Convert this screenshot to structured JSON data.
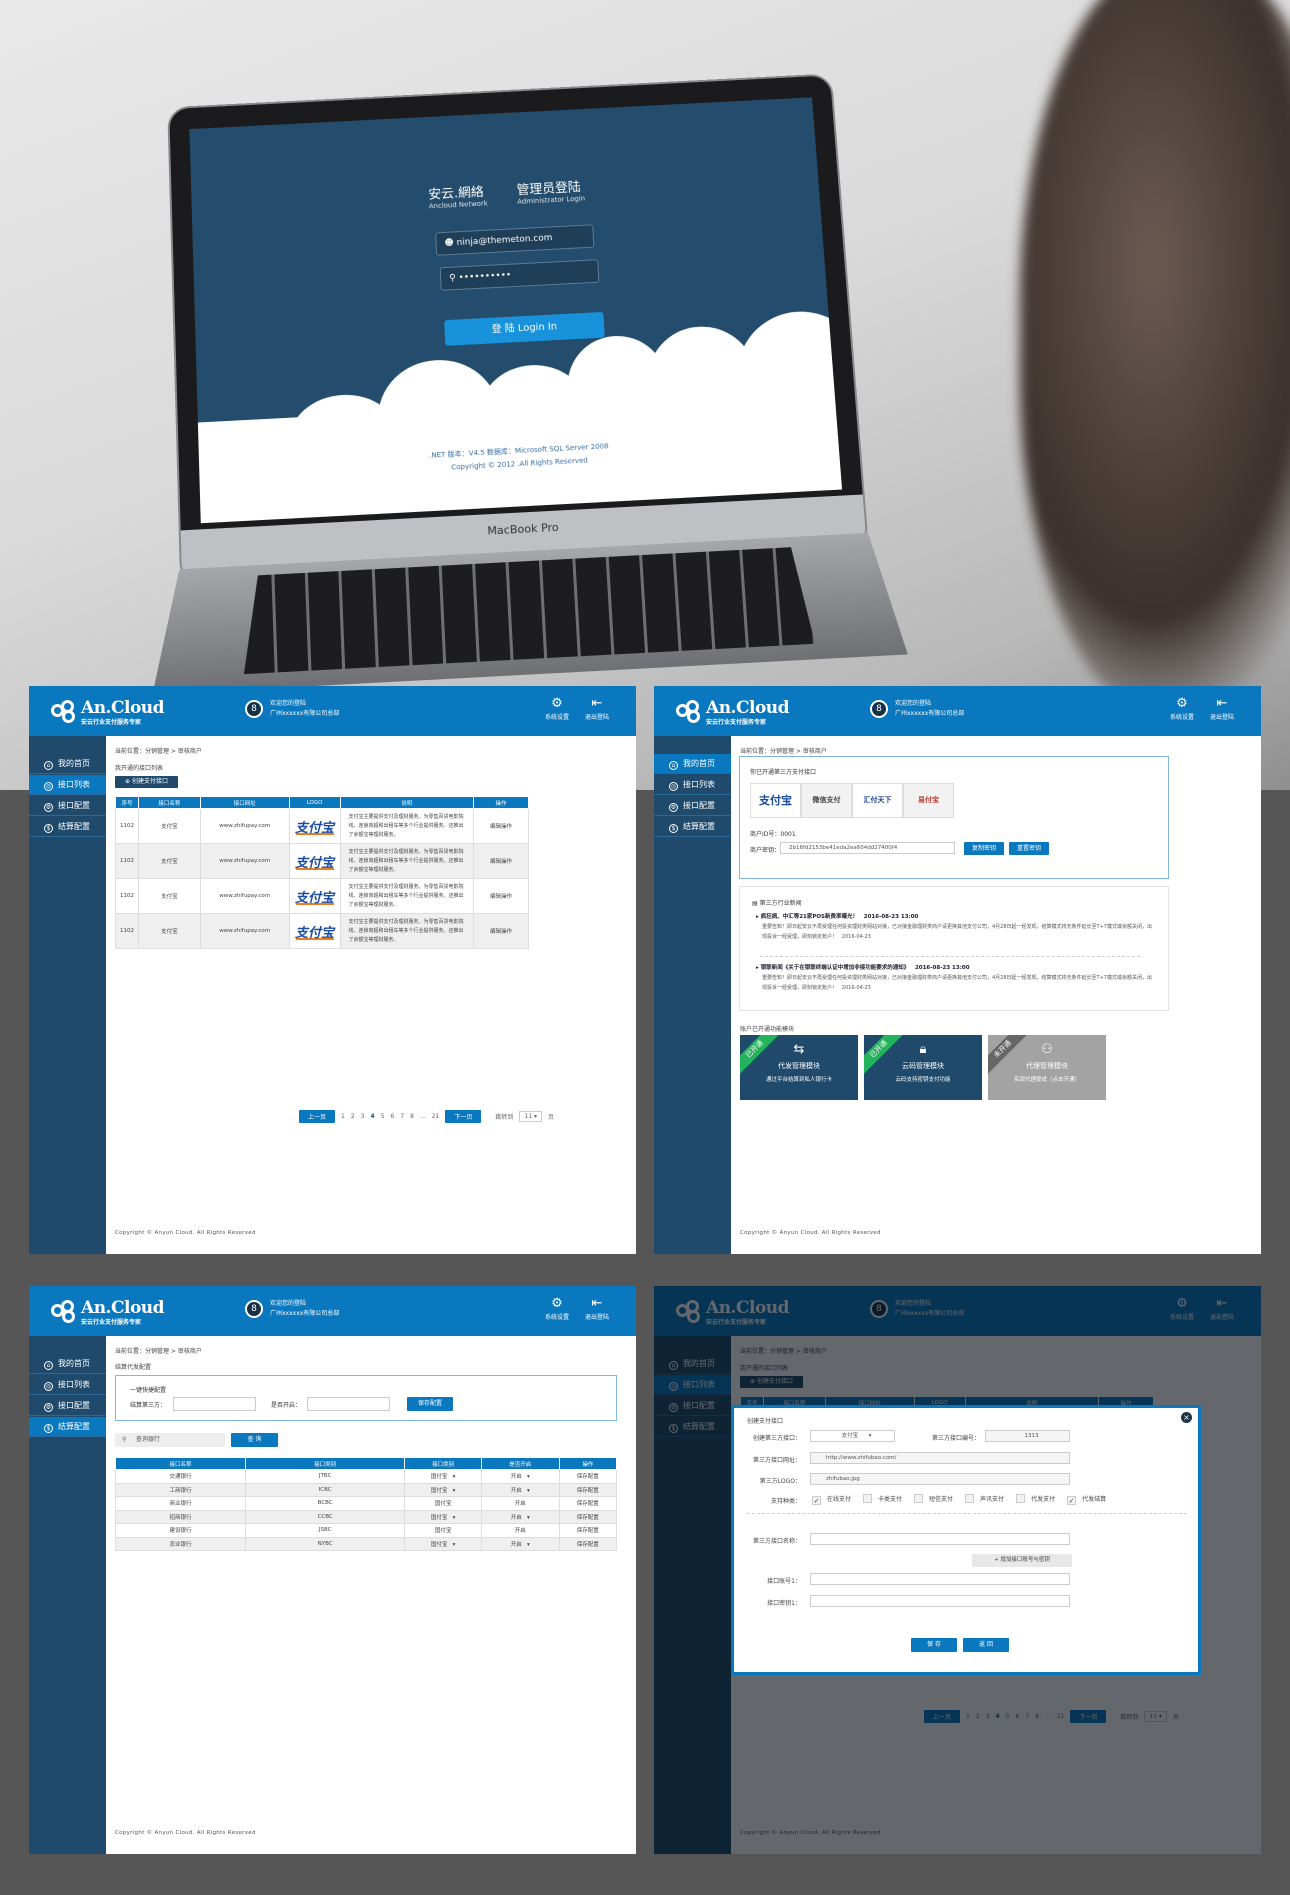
{
  "login": {
    "brand": "安云.網絡",
    "brand_en": "Ancloud Network",
    "title": "管理员登陆",
    "title_en": "Administrator Login",
    "email": "ninja@themeton.com",
    "password": "••••••••••",
    "button": "登 陆 Login In",
    "footer_version": ".NET 版本：V4.5   数据库：Microsoft SQL Server 2008",
    "footer_copyright": "Copyright © 2012 .All Rights Reserved",
    "laptop_label": "MacBook Pro"
  },
  "app": {
    "logo": "An.Cloud",
    "tagline": "安云行业支付服务专家",
    "welcome": "欢迎您的登陆",
    "company": "广州xxxxxx有限公司总部",
    "settings": "系统设置",
    "logout": "退出登陆",
    "nav": [
      "我的首页",
      "接口列表",
      "接口配置",
      "结算配置"
    ],
    "breadcrumb": "当前位置：分销管理 > 审核商户",
    "copyright": "Copyright © Anyun Cloud. All Rights Reserved",
    "brand_color": "#0a78bf",
    "sidebar_color": "#1f4a6b"
  },
  "interface_list": {
    "section_title": "我开通的接口列表",
    "create_button": "创建支付接口",
    "columns": [
      "序号",
      "接口名称",
      "接口网址",
      "LOGO",
      "说明",
      "操作"
    ],
    "rows": [
      {
        "id": "1102",
        "name": "支付宝",
        "url": "www.zhifupay.com",
        "logo": "支付宝",
        "desc": "支付宝主要提供支付及理财服务。为零售百货电影院线、连锁商超和出租车等多个行业提供服务。还推出了余额宝等理财服务。",
        "action": "编辑操作"
      },
      {
        "id": "1102",
        "name": "支付宝",
        "url": "www.zhifupay.com",
        "logo": "支付宝",
        "desc": "支付宝主要提供支付及理财服务。为零售百货电影院线、连锁商超和出租车等多个行业提供服务。还推出了余额宝等理财服务。",
        "action": "编辑操作"
      },
      {
        "id": "1102",
        "name": "支付宝",
        "url": "www.zhifupay.com",
        "logo": "支付宝",
        "desc": "支付宝主要提供支付及理财服务。为零售百货电影院线、连锁商超和出租车等多个行业提供服务。还推出了余额宝等理财服务。",
        "action": "编辑操作"
      },
      {
        "id": "1102",
        "name": "支付宝",
        "url": "www.zhifupay.com",
        "logo": "支付宝",
        "desc": "支付宝主要提供支付及理财服务。为零售百货电影院线、连锁商超和出租车等多个行业提供服务。还推出了余额宝等理财服务。",
        "action": "编辑操作"
      }
    ],
    "pagination": {
      "prev": "上一页",
      "pages": [
        "1",
        "2",
        "3",
        "4",
        "5",
        "6",
        "7",
        "8",
        "...",
        "21"
      ],
      "current": "4",
      "next": "下一页",
      "jump_label": "跳转到",
      "jump_value": "11",
      "page_unit": "页"
    }
  },
  "home": {
    "opened_title": "你已开通第三方支付接口",
    "providers": [
      "支付宝",
      "微信支付",
      "汇付天下",
      "易付宝"
    ],
    "merchant_id_label": "商户ID号：",
    "merchant_id": "0001",
    "merchant_key_label": "商户密钥：",
    "merchant_key": "2b16fd2153be41eda2ea604dd27400f4",
    "copy_key": "复制密钥",
    "reset_key": "重置密钥",
    "news_title": "第三方行业新闻",
    "news": [
      {
        "headline": "疯狂病、中汇等21家POS新费率曝光！",
        "time": "2016-08-23 13:00",
        "body": "重要告知！即日起安云不再受理任何投资理财类网站对接，已对接金融理财类商户请更换其他支付公司，4月28日起一经发现，结算模式将无条件延长至T+7模式或余额关闭，出现投诉一经受理，即刻锁定账户！",
        "date": "2016-04-23"
      },
      {
        "headline": "银联新闻《关于在银联终端认证中增加非接功能要求的通知》",
        "time": "2016-08-23 13:00",
        "body": "重要告知！即日起安云不再受理任何投资理财类网站对接，已对接金融理财类商户请更换其他支付公司，4月28日起一经发现，结算模式将无条件延长至T+7模式或余额关闭，出现投诉一经受理，即刻锁定账户！",
        "date": "2016-04-23"
      }
    ],
    "modules_title": "账户已开通功能模块",
    "modules": [
      {
        "badge": "已开通",
        "name": "代发管理模块",
        "desc": "通过平台结算到私人银行卡",
        "icon": "exchange-icon",
        "active": true
      },
      {
        "badge": "已开通",
        "name": "云码管理模块",
        "desc": "云码支持密钥支付功能",
        "icon": "lock-icon",
        "active": true
      },
      {
        "badge": "未开通",
        "name": "代理管理模块",
        "desc": "实现代理提成（点击开通）",
        "icon": "user-add-icon",
        "active": false
      }
    ]
  },
  "settlement": {
    "section_title": "结算代发配置",
    "quick_title": "一键快捷配置",
    "third_party_label": "结算第三方：",
    "enabled_label": "是否开启：",
    "save_config": "保存配置",
    "search_placeholder": "查询银行",
    "search_button": "查 询",
    "columns": [
      "接口名称",
      "接口类别",
      "接口类别",
      "是否开启",
      "操作"
    ],
    "rows": [
      {
        "name": "交通银行",
        "code": "JTBC",
        "type": "国付宝",
        "enabled": "开启",
        "dropdown": true,
        "action": "保存配置"
      },
      {
        "name": "工商银行",
        "code": "ICBC",
        "type": "国付宝",
        "enabled": "开启",
        "dropdown": true,
        "action": "保存配置"
      },
      {
        "name": "商业银行",
        "code": "BCBC",
        "type": "国付宝",
        "enabled": "开启",
        "dropdown": false,
        "action": "保存配置"
      },
      {
        "name": "招商银行",
        "code": "CCBC",
        "type": "国付宝",
        "enabled": "开启",
        "dropdown": true,
        "action": "保存配置"
      },
      {
        "name": "建设银行",
        "code": "JSBC",
        "type": "国付宝",
        "enabled": "开启",
        "dropdown": false,
        "action": "保存配置"
      },
      {
        "name": "农业银行",
        "code": "NYBC",
        "type": "国付宝",
        "enabled": "开启",
        "dropdown": true,
        "action": "保存配置"
      }
    ]
  },
  "modal": {
    "title": "创建支付接口",
    "provider_label": "创建第三方接口：",
    "provider_value": "支付宝",
    "number_label": "第三方接口编号：",
    "number_value": "1313",
    "url_label": "第三方接口网址：",
    "url_value": "http://www.zhifubao.com/",
    "logo_label": "第三方LOGO：",
    "logo_value": "zhifubao.jpg",
    "types_label": "支持种类：",
    "types": [
      {
        "label": "在线支付",
        "checked": true
      },
      {
        "label": "卡类支付",
        "checked": false
      },
      {
        "label": "短信支付",
        "checked": false
      },
      {
        "label": "声讯支付",
        "checked": false
      },
      {
        "label": "代发支付",
        "checked": false
      },
      {
        "label": "代发结算",
        "checked": true
      }
    ],
    "name_label": "第三方接口名称：",
    "add_account": "+ 增加接口账号与密钥",
    "account_label": "接口账号1：",
    "key_label": "接口密钥1：",
    "save": "保 存",
    "back": "返 回"
  }
}
